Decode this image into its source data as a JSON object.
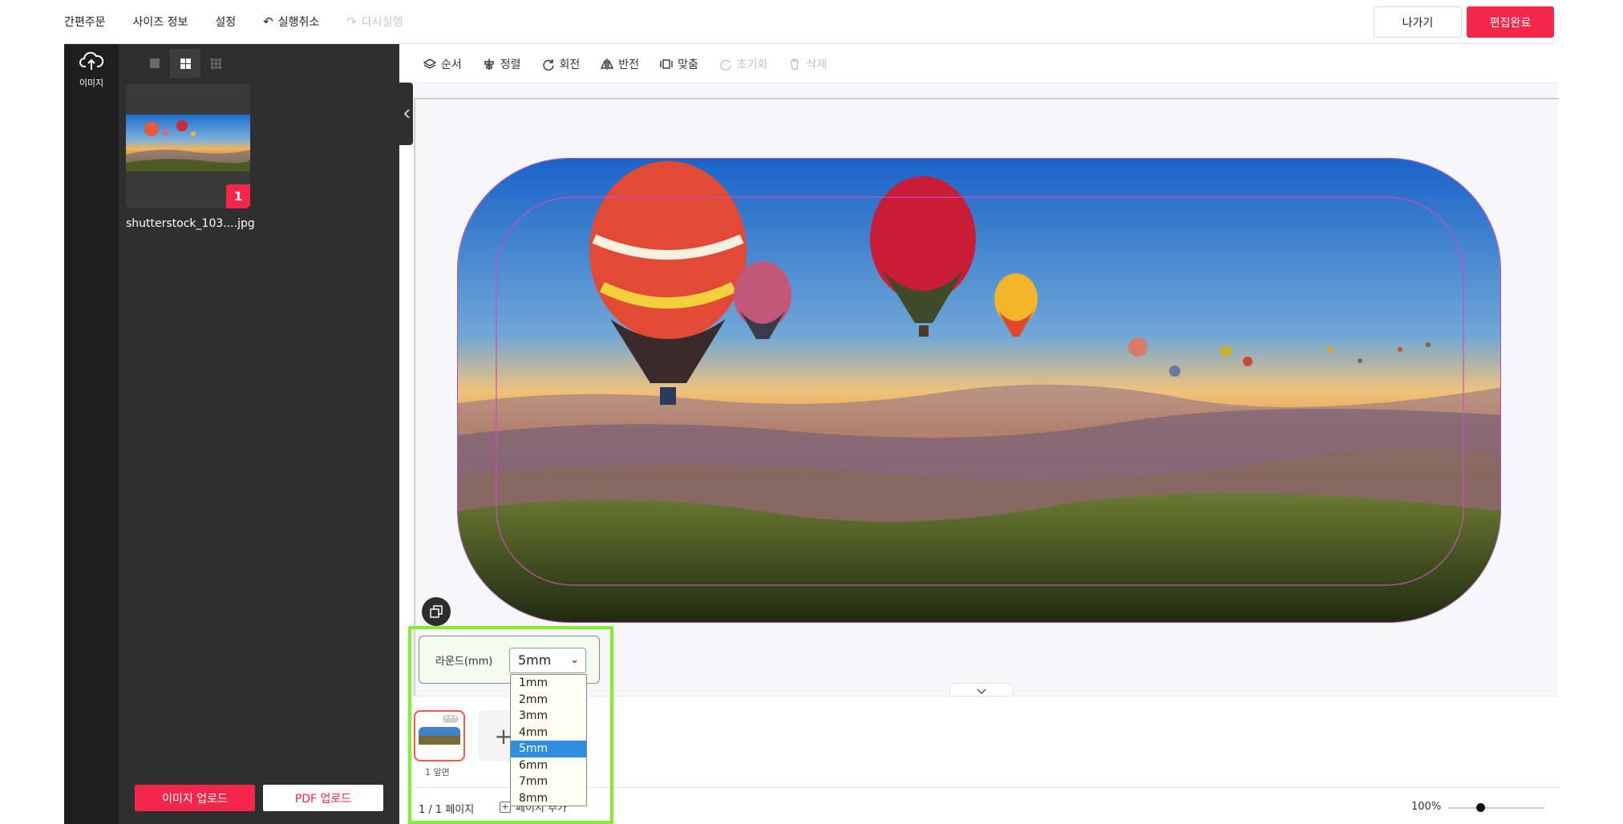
{
  "topbar": {
    "menu": [
      "간편주문",
      "사이즈 정보",
      "설정",
      "실행취소",
      "다시실행"
    ],
    "exit_label": "나가기",
    "done_label": "편집완료"
  },
  "rail": {
    "upload_label": "이미지"
  },
  "panel": {
    "file_name": "shutterstock_103....jpg",
    "use_count": "1",
    "image_upload_label": "이미지 업로드",
    "pdf_upload_label": "PDF 업로드"
  },
  "toolbar": {
    "tools": [
      "순서",
      "정렬",
      "회전",
      "반전",
      "맞춤",
      "초기화",
      "삭제"
    ]
  },
  "round": {
    "label": "라운드(mm)",
    "selected": "5mm",
    "options": [
      "1mm",
      "2mm",
      "3mm",
      "4mm",
      "5mm",
      "6mm",
      "7mm",
      "8mm"
    ]
  },
  "pages": {
    "page_label": "1 앞면",
    "count_label": "1 / 1 페이지",
    "add_label": "페이지 추가",
    "zoom": "100%"
  },
  "colors": {
    "accent": "#f4264a",
    "highlight": "#7ff02a",
    "dropdown_selected": "#2f8ee0"
  }
}
